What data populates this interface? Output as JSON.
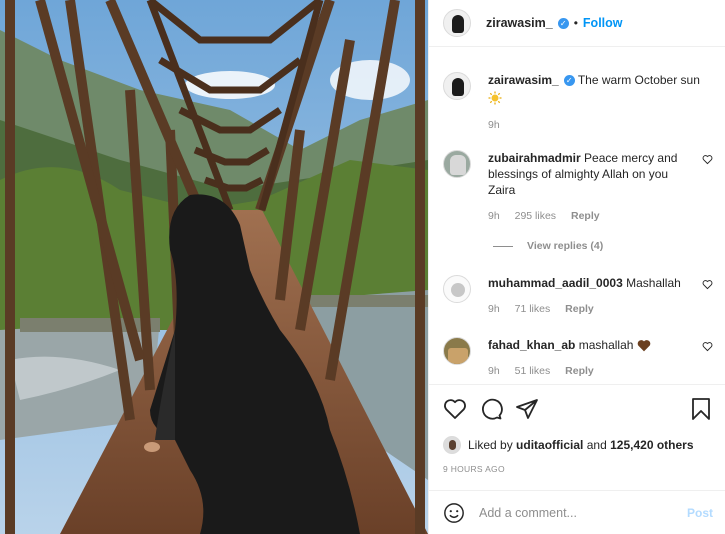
{
  "header": {
    "username": "zirawasim_",
    "verified_glyph": "✓",
    "dot": "•",
    "follow_label": "Follow"
  },
  "caption": {
    "username": "zairawasim_",
    "text": "The warm October sun",
    "emoji": "sun-emoji",
    "age": "9h"
  },
  "comments": [
    {
      "username": "zubairahmadmir",
      "text": "Peace mercy and blessings of almighty Allah on you Zaira",
      "age": "9h",
      "likes": "295 likes",
      "reply_label": "Reply"
    },
    {
      "username": "muhammad_aadil_0003",
      "text": "Mashallah",
      "age": "9h",
      "likes": "71 likes",
      "reply_label": "Reply"
    },
    {
      "username": "fahad_khan_ab",
      "text": "mashallah",
      "age": "9h",
      "likes": "51 likes",
      "reply_label": "Reply"
    }
  ],
  "view_replies": "View replies (4)",
  "actions": {
    "icons": [
      "heart-icon",
      "comment-icon",
      "share-icon",
      "bookmark-icon"
    ]
  },
  "likes": {
    "prefix": "Liked by",
    "user": "uditaofficial",
    "middle": "and",
    "count": "125,420 others"
  },
  "post_time": "9 HOURS AGO",
  "add_comment": {
    "placeholder": "Add a comment...",
    "post_label": "Post"
  },
  "colors": {
    "accent": "#0095f6",
    "verified": "#3897f0",
    "muted": "#8e8e8e"
  }
}
